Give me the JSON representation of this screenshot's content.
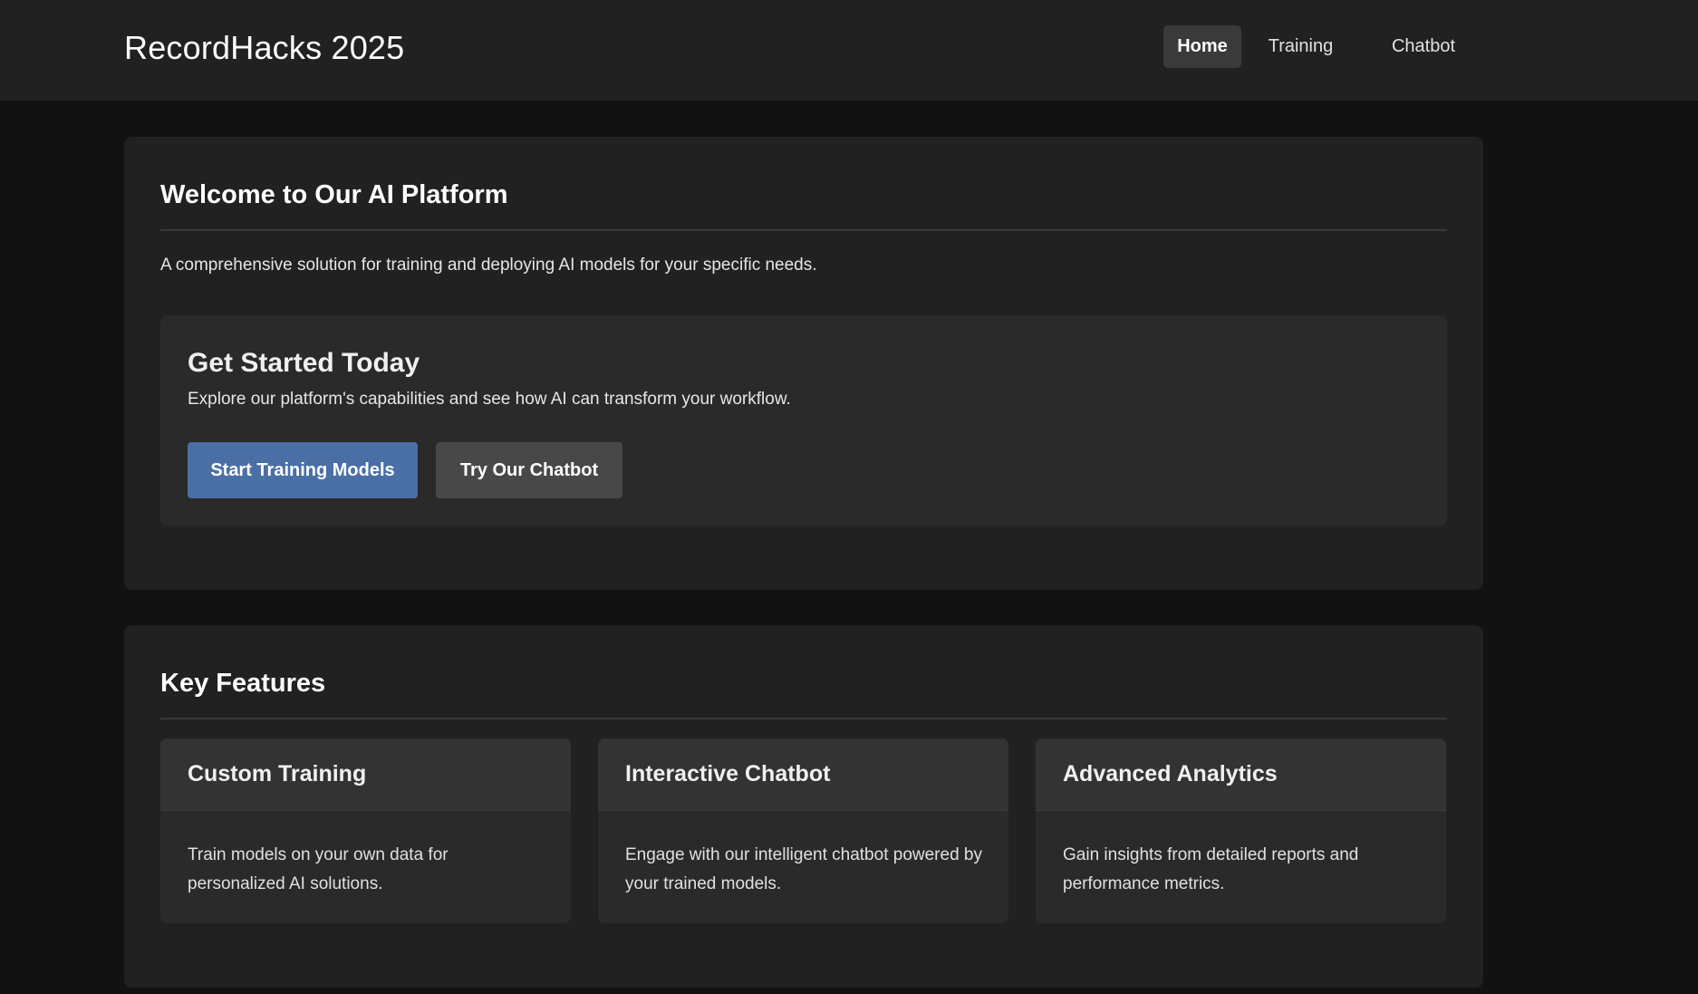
{
  "header": {
    "brand": "RecordHacks 2025",
    "nav": [
      {
        "label": "Home",
        "active": true
      },
      {
        "label": "Training",
        "active": false
      },
      {
        "label": "Chatbot",
        "active": false
      }
    ]
  },
  "welcome": {
    "title": "Welcome to Our AI Platform",
    "description": "A comprehensive solution for training and deploying AI models for your specific needs.",
    "cta": {
      "title": "Get Started Today",
      "description": "Explore our platform's capabilities and see how AI can transform your workflow.",
      "primary_button": "Start Training Models",
      "secondary_button": "Try Our Chatbot"
    }
  },
  "features": {
    "title": "Key Features",
    "cards": [
      {
        "title": "Custom Training",
        "body": "Train models on your own data for personalized AI solutions."
      },
      {
        "title": "Interactive Chatbot",
        "body": "Engage with our intelligent chatbot powered by your trained models."
      },
      {
        "title": "Advanced Analytics",
        "body": "Gain insights from detailed reports and performance metrics."
      }
    ]
  },
  "colors": {
    "page_bg": "#121212",
    "panel_bg": "#212121",
    "primary_button": "#4a6fa5",
    "secondary_button": "#484848"
  }
}
